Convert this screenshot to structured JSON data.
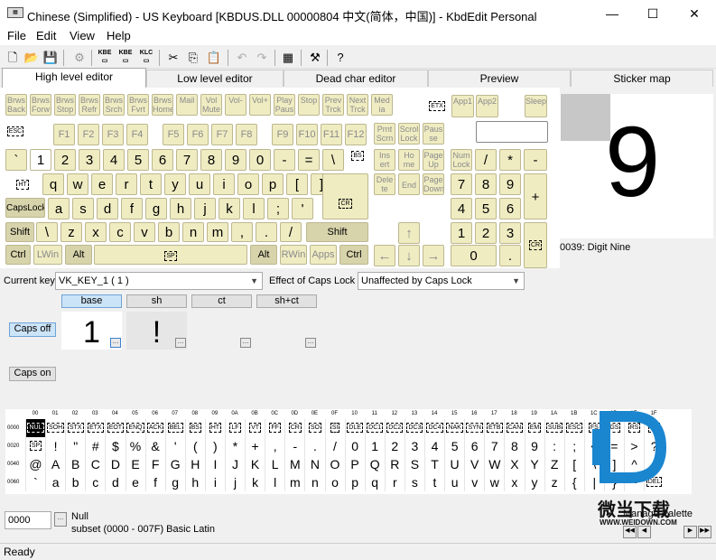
{
  "window": {
    "title": "Chinese (Simplified) - US Keyboard [KBDUS.DLL 00000804 中文(简体，中国)] - KbdEdit Personal",
    "minimize": "—",
    "maximize": "☐",
    "close": "✕"
  },
  "menu": [
    "File",
    "Edit",
    "View",
    "Help"
  ],
  "toolbar_labels": {
    "kbe": "KBE",
    "klc": "KLC"
  },
  "tabs": [
    "High level editor",
    "Low level editor",
    "Dead char editor",
    "Preview",
    "Sticker map"
  ],
  "keys": {
    "media": [
      "Brws Back",
      "Brws Forw",
      "Brws Stop",
      "Brws Refr",
      "Brws Srch",
      "Brws Fvrt",
      "Brws Home",
      "Mail",
      "Vol Mute",
      "Vol-",
      "Vol+",
      "Play Paus",
      "Stop",
      "Prev Trck",
      "Next Trck",
      "Med ia"
    ],
    "etx": "ETX",
    "app1": "App1",
    "app2": "App2",
    "sleep": "Sleep",
    "esc": "ESC",
    "fkeys": [
      "F1",
      "F2",
      "F3",
      "F4",
      "F5",
      "F6",
      "F7",
      "F8",
      "F9",
      "F10",
      "F11",
      "F12"
    ],
    "prnt": "Prnt Scrn",
    "scroll": "Scrol Lock",
    "pause": "Paus se",
    "row1": [
      "`",
      "1",
      "2",
      "3",
      "4",
      "5",
      "6",
      "7",
      "8",
      "9",
      "0",
      "-",
      "=",
      "\\"
    ],
    "bs": "BS",
    "ins": "Ins ert",
    "home": "Ho me",
    "pgup": "Page Up",
    "numlock": "Num Lock",
    "numdiv": "/",
    "nummul": "*",
    "numsub": "-",
    "ht": "HT",
    "row2": [
      "q",
      "w",
      "e",
      "r",
      "t",
      "y",
      "u",
      "i",
      "o",
      "p",
      "[",
      "]"
    ],
    "del": "Dele te",
    "end": "End",
    "pgdn": "Page Down",
    "num7": "7",
    "num8": "8",
    "num9": "9",
    "numadd": "+",
    "capslock": "CapsLock",
    "row3": [
      "a",
      "s",
      "d",
      "f",
      "g",
      "h",
      "j",
      "k",
      "l",
      ";",
      "'"
    ],
    "cr": "CR",
    "num4": "4",
    "num5": "5",
    "num6": "6",
    "shift": "Shift",
    "row4": [
      "\\",
      "z",
      "x",
      "c",
      "v",
      "b",
      "n",
      "m",
      ",",
      ".",
      "/"
    ],
    "rshift": "Shift",
    "up": "↑",
    "num1": "1",
    "num2": "2",
    "num3": "3",
    "ctrl": "Ctrl",
    "lwin": "LWin",
    "alt": "Alt",
    "sp": "SP",
    "ralt": "Alt",
    "rwin": "RWin",
    "apps": "Apps",
    "rctrl": "Ctrl",
    "left": "←",
    "down": "↓",
    "right": "→",
    "num0": "0",
    "numdot": "."
  },
  "preview": {
    "char": "9",
    "caption": "0039: Digit Nine"
  },
  "current_key": {
    "label": "Current key",
    "value": "VK_KEY_1 ( 1 )"
  },
  "caps_effect": {
    "label": "Effect of Caps Lock",
    "value": "Unaffected by Caps Lock"
  },
  "shift_states": [
    "base",
    "sh",
    "ct",
    "sh+ct"
  ],
  "cells": {
    "base": "1",
    "sh": "!"
  },
  "caps_off": "Caps off",
  "caps_on": "Caps on",
  "grid": {
    "cols": [
      "00",
      "01",
      "02",
      "03",
      "04",
      "05",
      "06",
      "07",
      "08",
      "09",
      "0A",
      "0B",
      "0C",
      "0D",
      "0E",
      "0F",
      "10",
      "11",
      "12",
      "13",
      "14",
      "15",
      "16",
      "17",
      "18",
      "19",
      "1A",
      "1B",
      "1C",
      "1D",
      "1E",
      "1F"
    ],
    "rows": [
      "0000",
      "0020",
      "0040",
      "0060"
    ],
    "row0": [
      "NUL",
      "SOH",
      "STX",
      "ETX",
      "EOT",
      "ENQ",
      "ACK",
      "BEL",
      "BS",
      "HT",
      "LF",
      "VT",
      "FF",
      "CR",
      "SO",
      "SI",
      "DLE",
      "DC1",
      "DC2",
      "DC3",
      "DC4",
      "NAK",
      "SYN",
      "ETB",
      "CAN",
      "EM",
      "SUB",
      "ESC",
      "FS",
      "GS",
      "RS",
      "US"
    ],
    "row1": [
      "SP",
      "!",
      "\"",
      "#",
      "$",
      "%",
      "&",
      "'",
      "(",
      ")",
      "*",
      "+",
      ",",
      "-",
      ".",
      "/",
      "0",
      "1",
      "2",
      "3",
      "4",
      "5",
      "6",
      "7",
      "8",
      "9",
      ":",
      ";",
      "<",
      "=",
      ">",
      "?"
    ],
    "row2": [
      "@",
      "A",
      "B",
      "C",
      "D",
      "E",
      "F",
      "G",
      "H",
      "I",
      "J",
      "K",
      "L",
      "M",
      "N",
      "O",
      "P",
      "Q",
      "R",
      "S",
      "T",
      "U",
      "V",
      "W",
      "X",
      "Y",
      "Z",
      "[",
      "\\",
      "]",
      "^",
      "_"
    ],
    "row3": [
      "`",
      "a",
      "b",
      "c",
      "d",
      "e",
      "f",
      "g",
      "h",
      "i",
      "j",
      "k",
      "l",
      "m",
      "n",
      "o",
      "p",
      "q",
      "r",
      "s",
      "t",
      "u",
      "v",
      "w",
      "x",
      "y",
      "z",
      "{",
      "|",
      "}",
      "~",
      "DEL"
    ]
  },
  "code_input": "0000",
  "code_name": "Null",
  "subset": "subset (0000 - 007F) Basic Latin",
  "manage_palette": "Manage Palette",
  "watermark": "微当下载",
  "watermark_url": "WWW.WEIDOWN.COM",
  "status": "Ready"
}
